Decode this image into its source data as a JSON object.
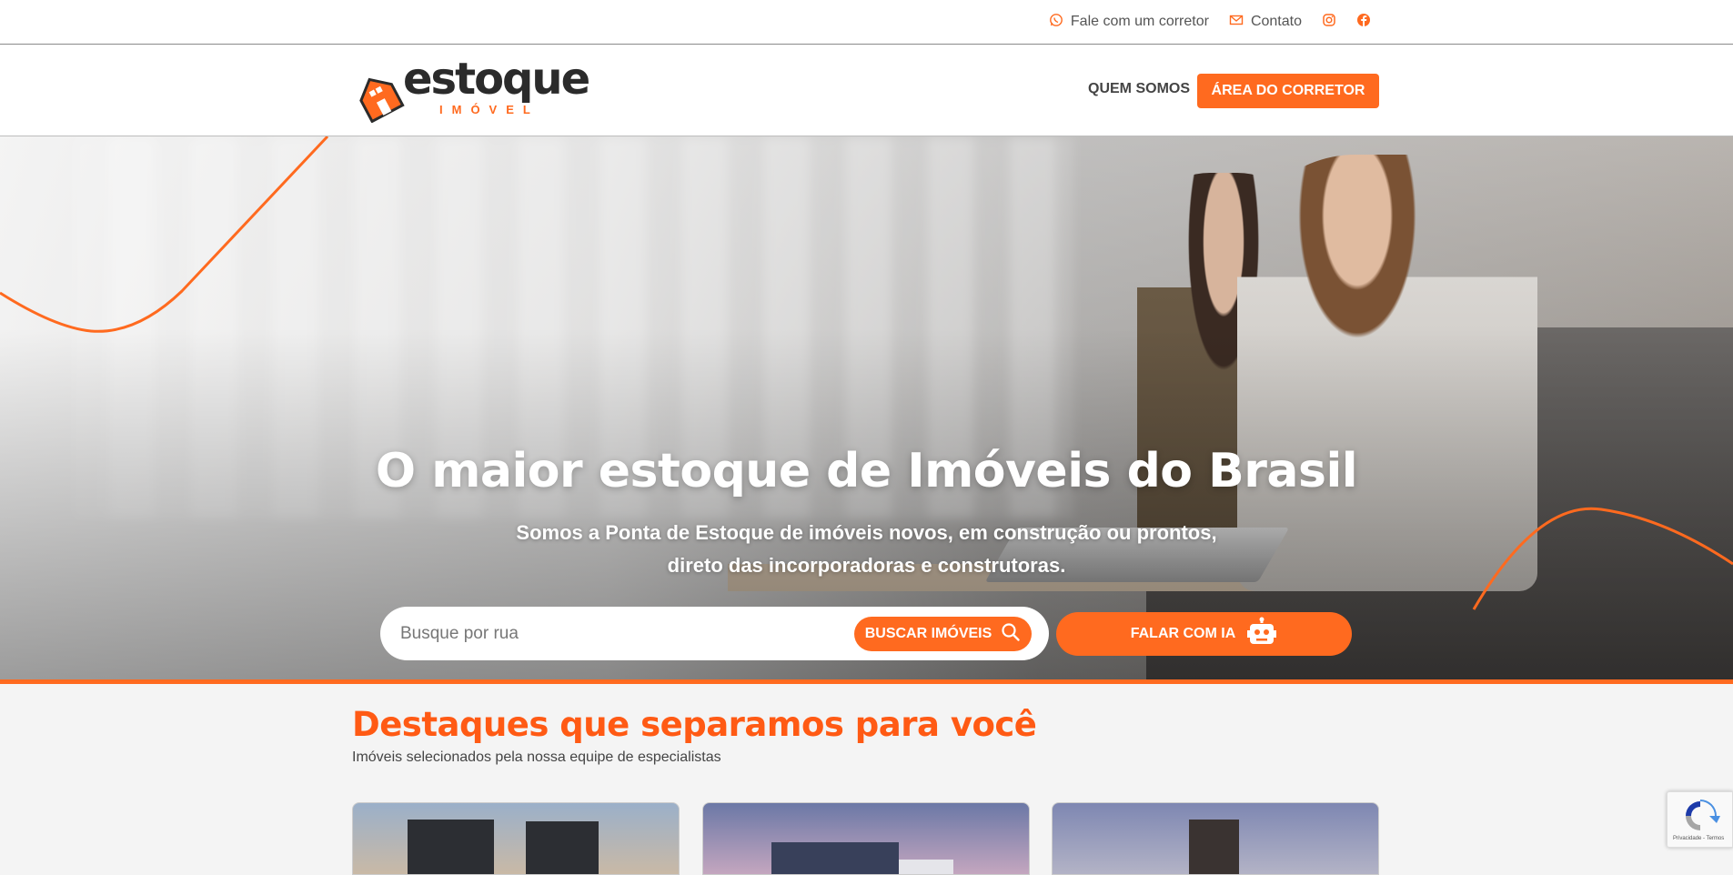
{
  "topbar": {
    "whatsapp_label": "Fale com um corretor",
    "contact_label": "Contato"
  },
  "header": {
    "logo_word": "estoque",
    "logo_sub": "IMÓVEL",
    "nav_about": "QUEM SOMOS",
    "broker_area_button": "ÁREA DO CORRETOR"
  },
  "hero": {
    "title": "O maior estoque de Imóveis do Brasil",
    "subtitle_line1": "Somos a Ponta de Estoque de imóveis novos, em construção ou prontos,",
    "subtitle_line2": "direto das incorporadoras e construtoras.",
    "search_placeholder": "Busque por rua",
    "search_button": "BUSCAR IMÓVEIS",
    "ai_button": "FALAR COM IA"
  },
  "highlights": {
    "title": "Destaques que separamos para você",
    "subtitle": "Imóveis selecionados pela nossa equipe de especialistas"
  },
  "recaptcha": {
    "text": "Privacidade - Termos"
  },
  "colors": {
    "accent": "#ff6a1f",
    "heading_accent": "#ff5a14",
    "text_dark": "#2b2b2b"
  }
}
